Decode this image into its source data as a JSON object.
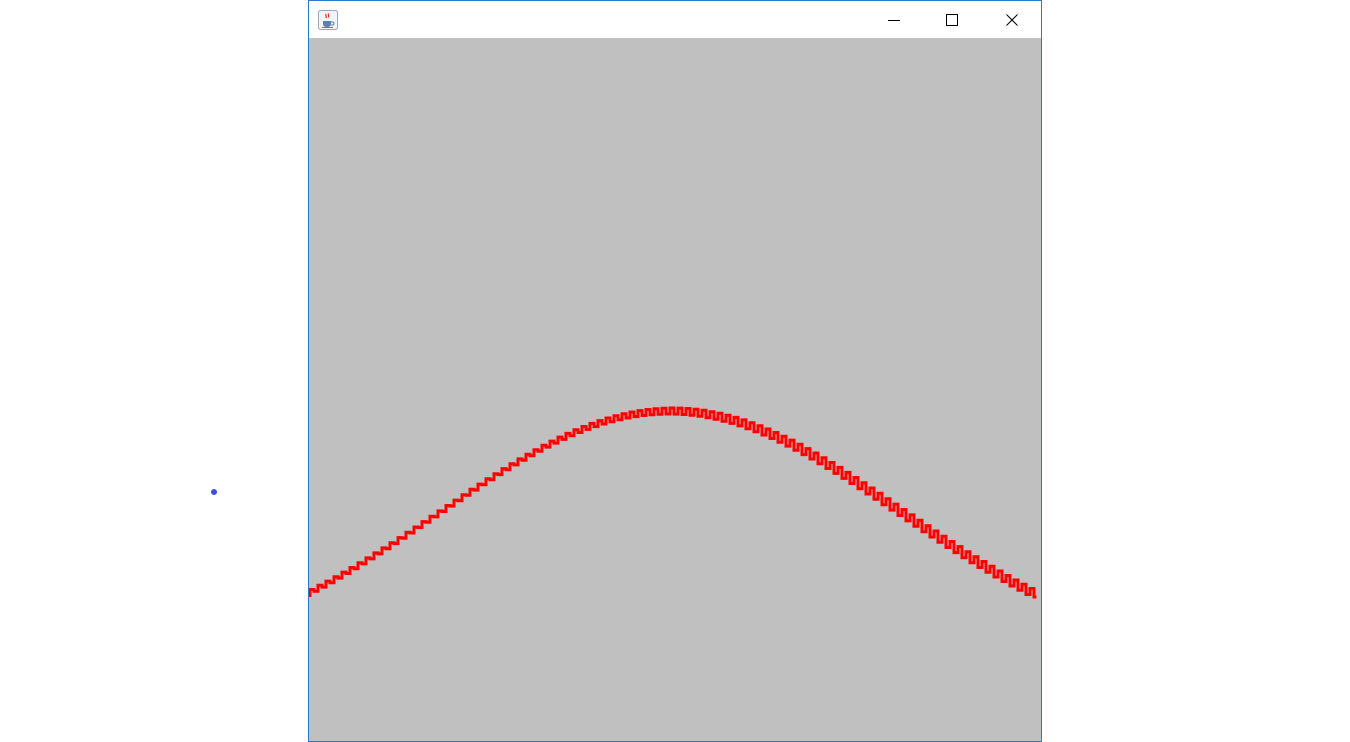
{
  "window": {
    "title": "",
    "icon": "java-cup-icon",
    "controls": [
      "minimize-icon",
      "maximize-icon",
      "close-icon"
    ]
  },
  "canvas": {
    "background": "#c0c0c0",
    "curve_color": "#ff0000",
    "curve_shape": "stepped-bell"
  },
  "cursor": {
    "color": "#3b4fe0"
  }
}
